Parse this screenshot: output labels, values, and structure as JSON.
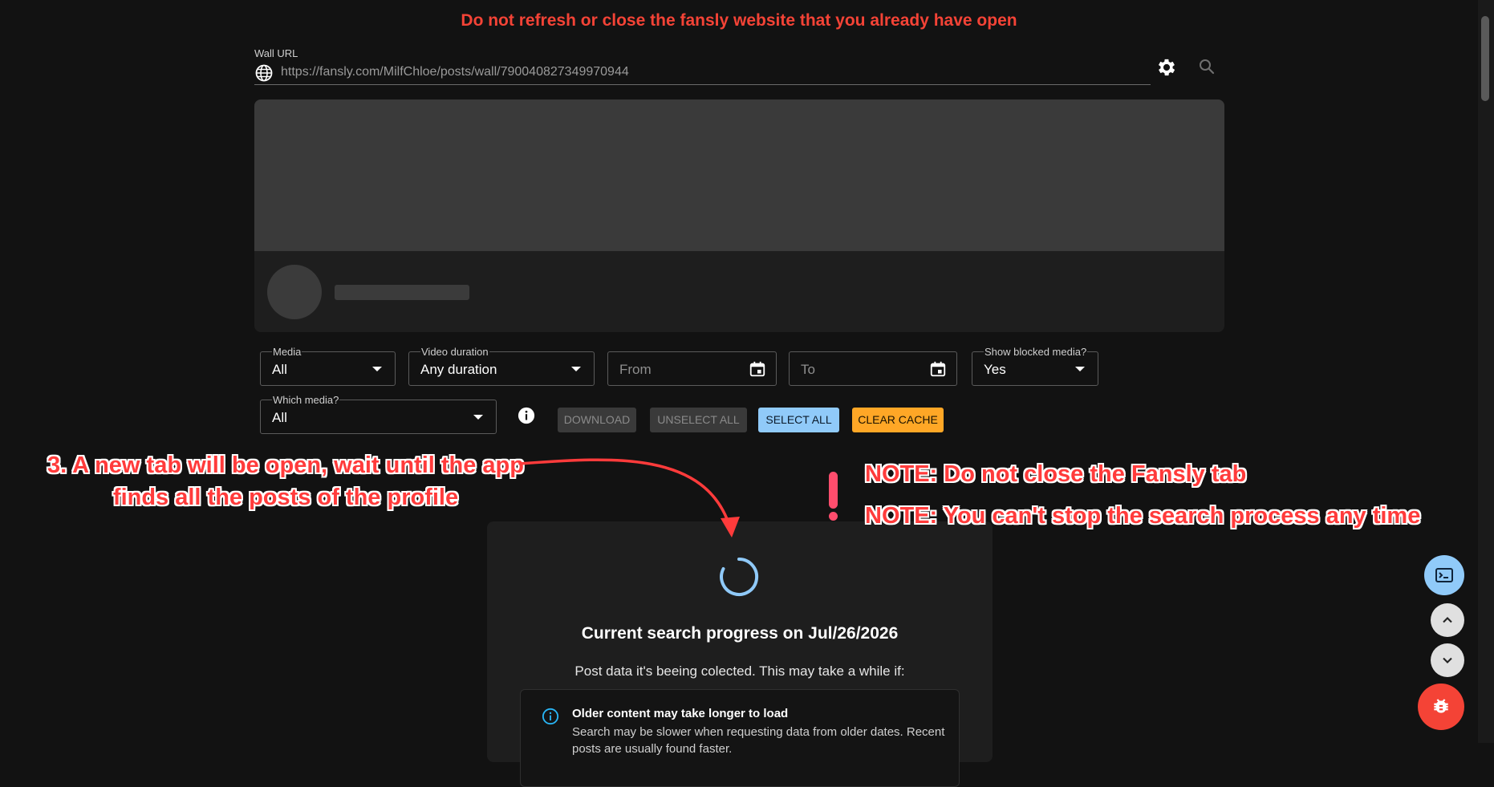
{
  "warning": "Do not refresh or close the fansly website that you already have open",
  "url_field": {
    "label": "Wall URL",
    "value": "https://fansly.com/MilfChloe/posts/wall/790040827349970944"
  },
  "filters": {
    "media": {
      "label": "Media",
      "value": "All"
    },
    "video_duration": {
      "label": "Video duration",
      "value": "Any duration"
    },
    "from": {
      "placeholder": "From"
    },
    "to": {
      "placeholder": "To"
    },
    "show_blocked": {
      "label": "Show blocked media?",
      "value": "Yes"
    },
    "which_media": {
      "label": "Which media?",
      "value": "All"
    }
  },
  "actions": {
    "download": "DOWNLOAD",
    "unselect_all": "UNSELECT ALL",
    "select_all": "SELECT ALL",
    "clear_cache": "CLEAR CACHE"
  },
  "annotations": {
    "step": "3. A new tab will be open, wait until the app finds all the posts of the profile",
    "note1": "NOTE: Do not close the Fansly tab",
    "note2": "NOTE: You can't stop the search process any time"
  },
  "progress": {
    "title": "Current search progress on Jul/26/2026",
    "subtitle": "Post data it's beeing colected. This may take a while if:",
    "alert_title": "Older content may take longer to load",
    "alert_text": "Search may be slower when requesting data from older dates. Recent posts are usually found faster."
  },
  "colors": {
    "warning": "#f44336",
    "select_all_bg": "#90caf9",
    "clear_cache_bg": "#ffa726",
    "bug_fab": "#f44336",
    "annotation": "#ff3b3b"
  },
  "icons": [
    "globe-icon",
    "gear-icon",
    "search-icon",
    "calendar-icon",
    "info-icon",
    "terminal-icon",
    "chevron-up-icon",
    "chevron-down-icon",
    "bug-icon"
  ]
}
